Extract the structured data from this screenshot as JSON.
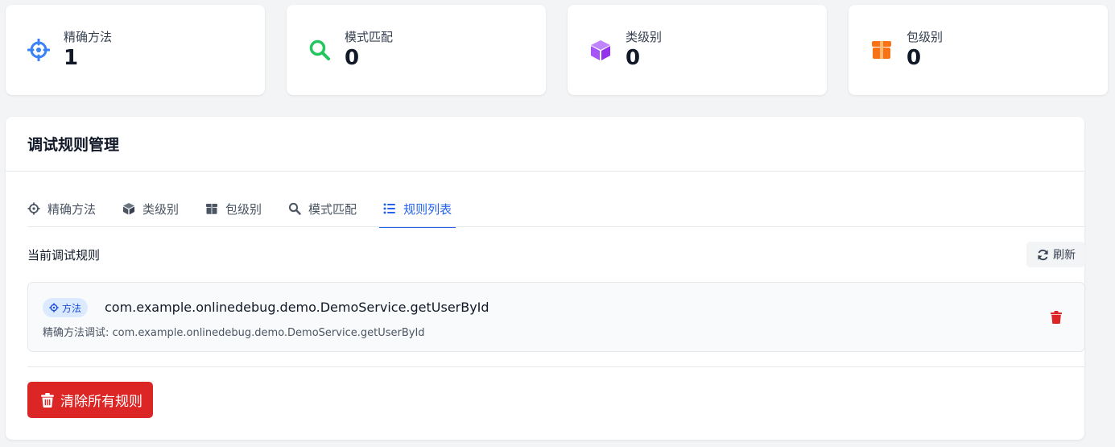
{
  "stats": [
    {
      "label": "精确方法",
      "value": "1",
      "icon": "crosshairs-icon",
      "color": "#3b82f6"
    },
    {
      "label": "模式匹配",
      "value": "0",
      "icon": "search-icon",
      "color": "#22c55e"
    },
    {
      "label": "类级别",
      "value": "0",
      "icon": "cube-icon",
      "color": "#a855f7"
    },
    {
      "label": "包级别",
      "value": "0",
      "icon": "box-icon",
      "color": "#f97316"
    }
  ],
  "panel": {
    "title": "调试规则管理",
    "tabs": [
      {
        "label": "精确方法",
        "icon": "crosshairs-icon"
      },
      {
        "label": "类级别",
        "icon": "cube-icon"
      },
      {
        "label": "包级别",
        "icon": "box-icon"
      },
      {
        "label": "模式匹配",
        "icon": "search-icon"
      },
      {
        "label": "规则列表",
        "icon": "list-icon",
        "active": true
      }
    ],
    "section_title": "当前调试规则",
    "refresh_label": "刷新",
    "rules": [
      {
        "badge": "方法",
        "target": "com.example.onlinedebug.demo.DemoService.getUserById",
        "description": "精确方法调试: com.example.onlinedebug.demo.DemoService.getUserById"
      }
    ],
    "clear_all_label": "清除所有规则"
  },
  "colors": {
    "accent": "#2563eb",
    "danger": "#dc2626",
    "badge_bg": "#dbeafe"
  }
}
